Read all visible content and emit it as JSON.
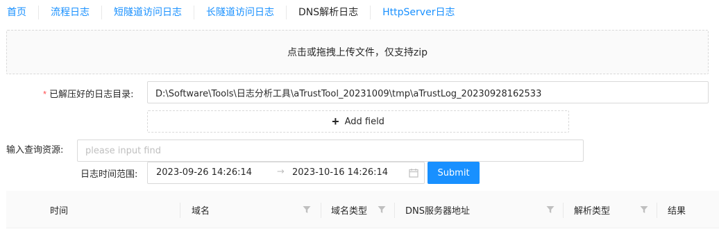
{
  "nav": {
    "items": [
      {
        "label": "首页"
      },
      {
        "label": "流程日志"
      },
      {
        "label": "短隧道访问日志"
      },
      {
        "label": "长隧道访问日志"
      },
      {
        "label": "DNS解析日志",
        "active": true
      },
      {
        "label": "HttpServer日志"
      }
    ]
  },
  "upload": {
    "text": "点击或拖拽上传文件，仅支持zip"
  },
  "form": {
    "log_dir": {
      "required_mark": "*",
      "label": "已解压好的日志目录:",
      "value": "D:\\Software\\Tools\\日志分析工具\\aTrustTool_20231009\\tmp\\aTrustLog_20230928162533"
    },
    "add_field_label": "Add field",
    "query": {
      "label": "输入查询资源:",
      "placeholder": "please input find"
    },
    "time_range": {
      "label": "日志时间范围:",
      "start": "2023-09-26 14:26:14",
      "separator": "→",
      "end": "2023-10-16 14:26:14"
    },
    "submit_label": "Submit"
  },
  "table": {
    "columns": [
      {
        "label": "时间",
        "filter": false
      },
      {
        "label": "域名",
        "filter": true
      },
      {
        "label": "域名类型",
        "filter": true
      },
      {
        "label": "DNS服务器地址",
        "filter": true
      },
      {
        "label": "解析类型",
        "filter": true
      },
      {
        "label": "结果",
        "filter": false
      }
    ]
  },
  "icons": {
    "add": "plus-icon",
    "calendar": "calendar-icon",
    "filter": "filter-icon"
  },
  "colors": {
    "primary": "#1890ff",
    "required": "#ff4d4f"
  }
}
